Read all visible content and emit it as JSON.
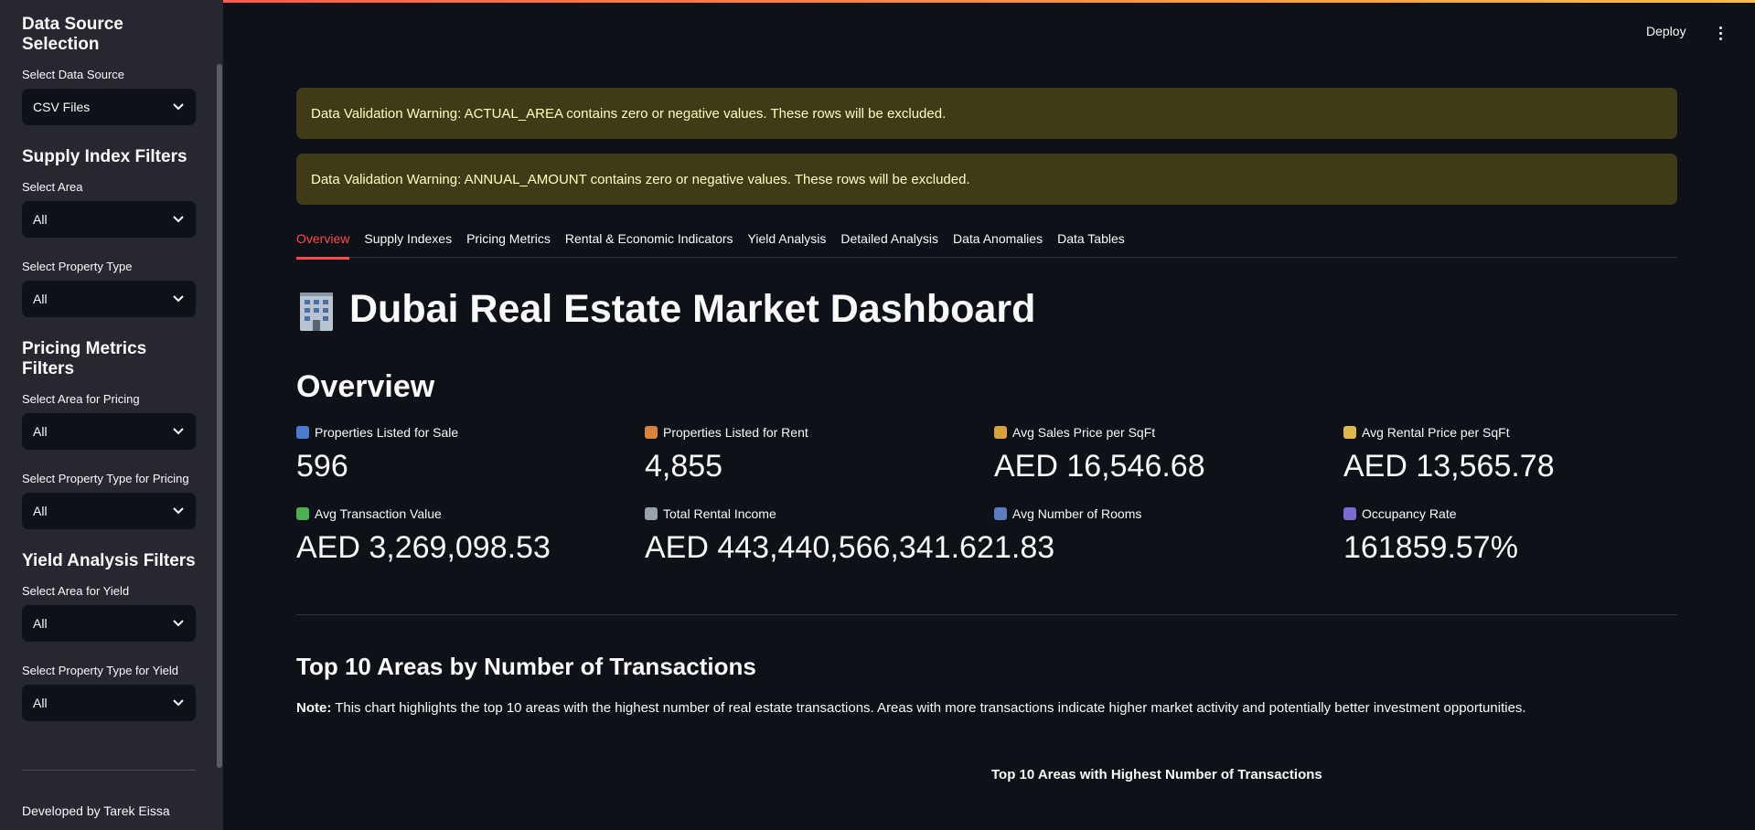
{
  "sidebar": {
    "data_source": {
      "title": "Data Source Selection",
      "label": "Select Data Source",
      "value": "CSV Files"
    },
    "supply_filters": {
      "title": "Supply Index Filters",
      "area_label": "Select Area",
      "area_value": "All",
      "ptype_label": "Select Property Type",
      "ptype_value": "All"
    },
    "pricing_filters": {
      "title": "Pricing Metrics Filters",
      "area_label": "Select Area for Pricing",
      "area_value": "All",
      "ptype_label": "Select Property Type for Pricing",
      "ptype_value": "All"
    },
    "yield_filters": {
      "title": "Yield Analysis Filters",
      "area_label": "Select Area for Yield",
      "area_value": "All",
      "ptype_label": "Select Property Type for Yield",
      "ptype_value": "All"
    },
    "footer": "Developed by Tarek Eissa"
  },
  "header": {
    "deploy_label": "Deploy"
  },
  "alerts": [
    "Data Validation Warning: ACTUAL_AREA contains zero or negative values. These rows will be excluded.",
    "Data Validation Warning: ANNUAL_AMOUNT contains zero or negative values. These rows will be excluded."
  ],
  "tabs": [
    "Overview",
    "Supply Indexes",
    "Pricing Metrics",
    "Rental & Economic Indicators",
    "Yield Analysis",
    "Detailed Analysis",
    "Data Anomalies",
    "Data Tables"
  ],
  "page_title": "Dubai Real Estate Market Dashboard",
  "section_title": "Overview",
  "metrics": [
    {
      "label": "Properties Listed for Sale",
      "value": "596",
      "icon": "chart-up-icon",
      "color": "#4a7bd0"
    },
    {
      "label": "Properties Listed for Rent",
      "value": "4,855",
      "icon": "house-icon",
      "color": "#d9823b"
    },
    {
      "label": "Avg Sales Price per SqFt",
      "value": "AED 16,546.68",
      "icon": "money-bag-icon",
      "color": "#d8a23a"
    },
    {
      "label": "Avg Rental Price per SqFt",
      "value": "AED 13,565.78",
      "icon": "price-tag-icon",
      "color": "#e0b84a"
    },
    {
      "label": "Avg Transaction Value",
      "value": "AED 3,269,098.53",
      "icon": "dollar-bill-icon",
      "color": "#4caf50"
    },
    {
      "label": "Total Rental Income",
      "value": "AED 443,440,566,341.62",
      "icon": "building-icon",
      "color": "#9aa3ad"
    },
    {
      "label": "Avg Number of Rooms",
      "value": "1.83",
      "icon": "bed-icon",
      "color": "#5a7fc0"
    },
    {
      "label": "Occupancy Rate",
      "value": "161859.57%",
      "icon": "bar-chart-icon",
      "color": "#7b6ad0"
    }
  ],
  "top_areas": {
    "title": "Top 10 Areas by Number of Transactions",
    "note_prefix": "Note:",
    "note_text": " This chart highlights the top 10 areas with the highest number of real estate transactions. Areas with more transactions indicate higher market activity and potentially better investment opportunities.",
    "chart_title": "Top 10 Areas with Highest Number of Transactions"
  },
  "colors": {
    "background": "#0e1117",
    "sidebar": "#262730",
    "accent": "#ff4b4b",
    "warning_bg": "#3e3b16",
    "warning_text": "#ffffc2"
  }
}
